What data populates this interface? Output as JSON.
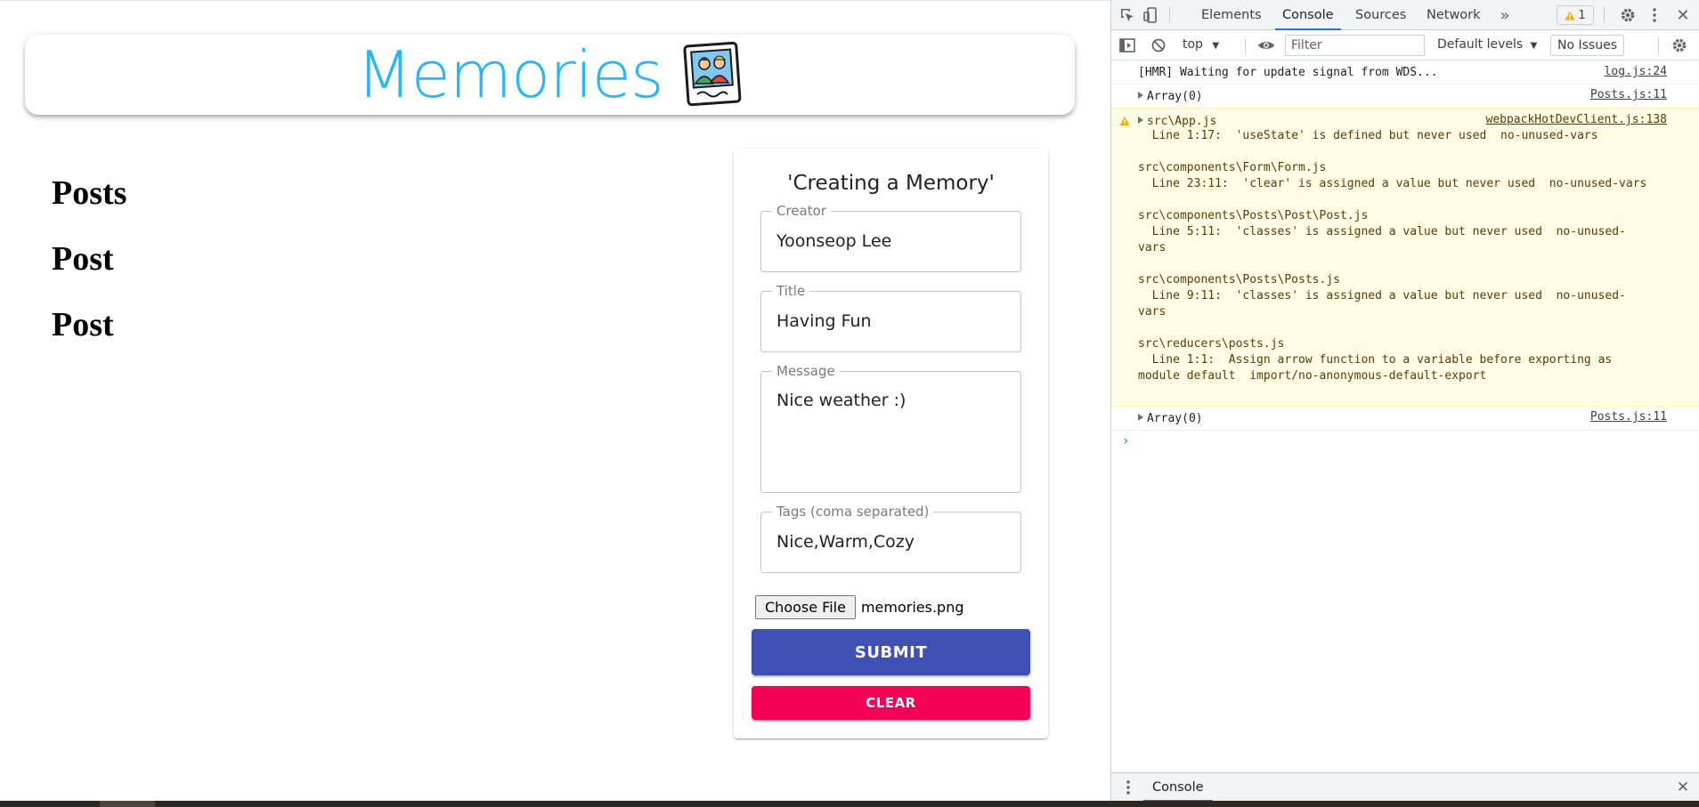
{
  "app": {
    "title": "Memories",
    "logo_icon": "memories-photo-icon",
    "accent_color": "#29b6f6",
    "posts_heading": "Posts",
    "post_items": [
      "Post",
      "Post"
    ],
    "form": {
      "title": "'Creating a Memory'",
      "fields": [
        {
          "label": "Creator",
          "value": "Yoonseop Lee"
        },
        {
          "label": "Title",
          "value": "Having Fun"
        },
        {
          "label": "Message",
          "value": "Nice weather :)"
        },
        {
          "label": "Tags (coma separated)",
          "value": "Nice,Warm,Cozy"
        }
      ],
      "file_button": "Choose File",
      "file_name": "memories.png",
      "submit_label": "SUBMIT",
      "clear_label": "CLEAR",
      "submit_color": "#3f51b5",
      "clear_color": "#f50057"
    }
  },
  "devtools": {
    "tabs": [
      "Elements",
      "Console",
      "Sources",
      "Network"
    ],
    "active_tab": "Console",
    "more_tabs_icon": "chevron-double-right-icon",
    "warning_count": "1",
    "context": "top",
    "filter_placeholder": "Filter",
    "levels": "Default levels",
    "issues": "No Issues",
    "messages": [
      {
        "type": "log",
        "text": "[HMR] Waiting for update signal from WDS...",
        "source": "log.js:24"
      },
      {
        "type": "tree",
        "text": "Array(0)",
        "source": "Posts.js:11"
      },
      {
        "type": "warning",
        "head": "src\\App.js",
        "source": "webpackHotDevClient.js:138",
        "body": "  Line 1:17:  'useState' is defined but never used  no-unused-vars\n\nsrc\\components\\Form\\Form.js\n  Line 23:11:  'clear' is assigned a value but never used  no-unused-vars\n\nsrc\\components\\Posts\\Post\\Post.js\n  Line 5:11:  'classes' is assigned a value but never used  no-unused-\nvars\n\nsrc\\components\\Posts\\Posts.js\n  Line 9:11:  'classes' is assigned a value but never used  no-unused-\nvars\n\nsrc\\reducers\\posts.js\n  Line 1:1:  Assign arrow function to a variable before exporting as\nmodule default  import/no-anonymous-default-export"
      },
      {
        "type": "tree",
        "text": "Array(0)",
        "source": "Posts.js:11"
      }
    ],
    "drawer_tab": "Console"
  }
}
